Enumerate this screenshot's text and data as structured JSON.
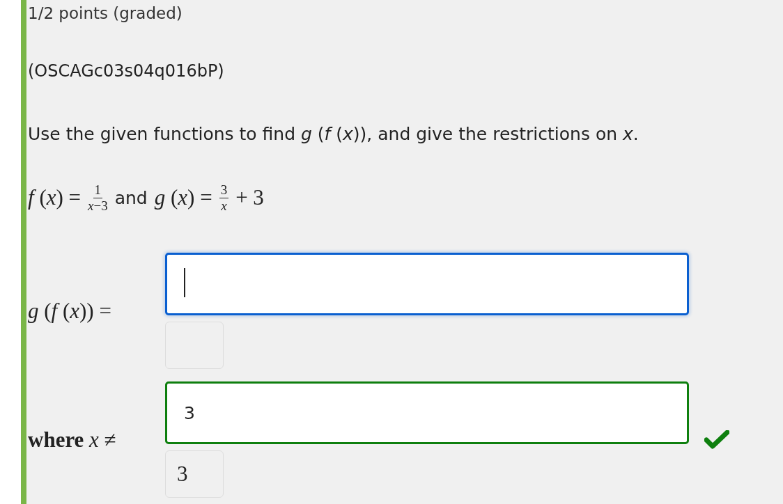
{
  "score": "1/2 points (graded)",
  "problem_id": "(OSCAGc03s04q016bP)",
  "prompt": "Use the given functions to find *g* (*f* (*x*)), and give the restrictions on *x*.",
  "definition": [
    {
      "kind": "math",
      "text": "*f* (*x*) ="
    },
    {
      "kind": "fraction",
      "numerator": "1",
      "denominator": "*x*−3"
    },
    {
      "kind": "text",
      "text": "and"
    },
    {
      "kind": "math",
      "text": "*g* (*x*) ="
    },
    {
      "kind": "fraction",
      "numerator": "3",
      "denominator": "*x*"
    },
    {
      "kind": "math",
      "text": "+ 3"
    }
  ],
  "answers": [
    {
      "label": "*g* (*f* (*x*)) =",
      "focused": true,
      "correct": false
    },
    {
      "label": "**where** *x* ≠",
      "value": "3",
      "focused": false,
      "correct": true,
      "preview": "3"
    }
  ]
}
